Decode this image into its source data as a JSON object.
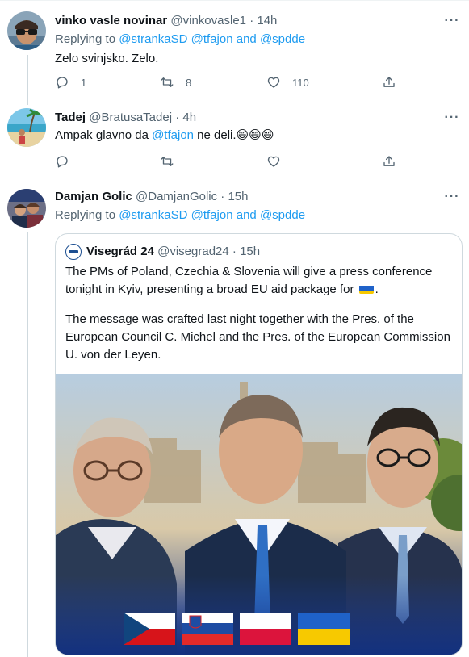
{
  "tweets": [
    {
      "name": "vinko vasle novinar",
      "handle": "@vinkovasle1",
      "time": "14h",
      "reply_prefix": "Replying to",
      "mentions": [
        "@strankaSD",
        "@tfajon",
        "@spdde"
      ],
      "and_word": "and",
      "text": "Zelo svinjsko. Zelo.",
      "reply_count": "1",
      "retweet_count": "8",
      "like_count": "110"
    },
    {
      "name": "Tadej",
      "handle": "@BratusaTadej",
      "time": "4h",
      "text_before": "Ampak glavno da",
      "text_mention": "@tfajon",
      "text_after": "ne deli.",
      "emoji": "😄😄😄"
    },
    {
      "name": "Damjan Golic",
      "handle": "@DamjanGolic",
      "time": "15h",
      "reply_prefix": "Replying to",
      "mentions": [
        "@strankaSD",
        "@tfajon",
        "@spdde"
      ],
      "and_word": "and"
    }
  ],
  "quoted": {
    "name": "Visegrád 24",
    "handle": "@visegrad24",
    "time": "15h",
    "lines": [
      "The PMs of Poland, Czechia & Slovenia will give a press conference",
      "tonight in Kyiv, presenting a broad EU aid package for",
      "The message was crafted last night together with the Pres. of the",
      "European Council C. Michel and the Pres. of the European Commission",
      "U. von der Leyen."
    ],
    "image_flags": [
      "flag-czechia",
      "flag-slovenia",
      "flag-poland",
      "flag-ukraine"
    ]
  },
  "separator": "·",
  "colors": {
    "text": "#0f1419",
    "muted": "#536471",
    "link": "#1d9bf0",
    "border": "#cfd9de"
  }
}
